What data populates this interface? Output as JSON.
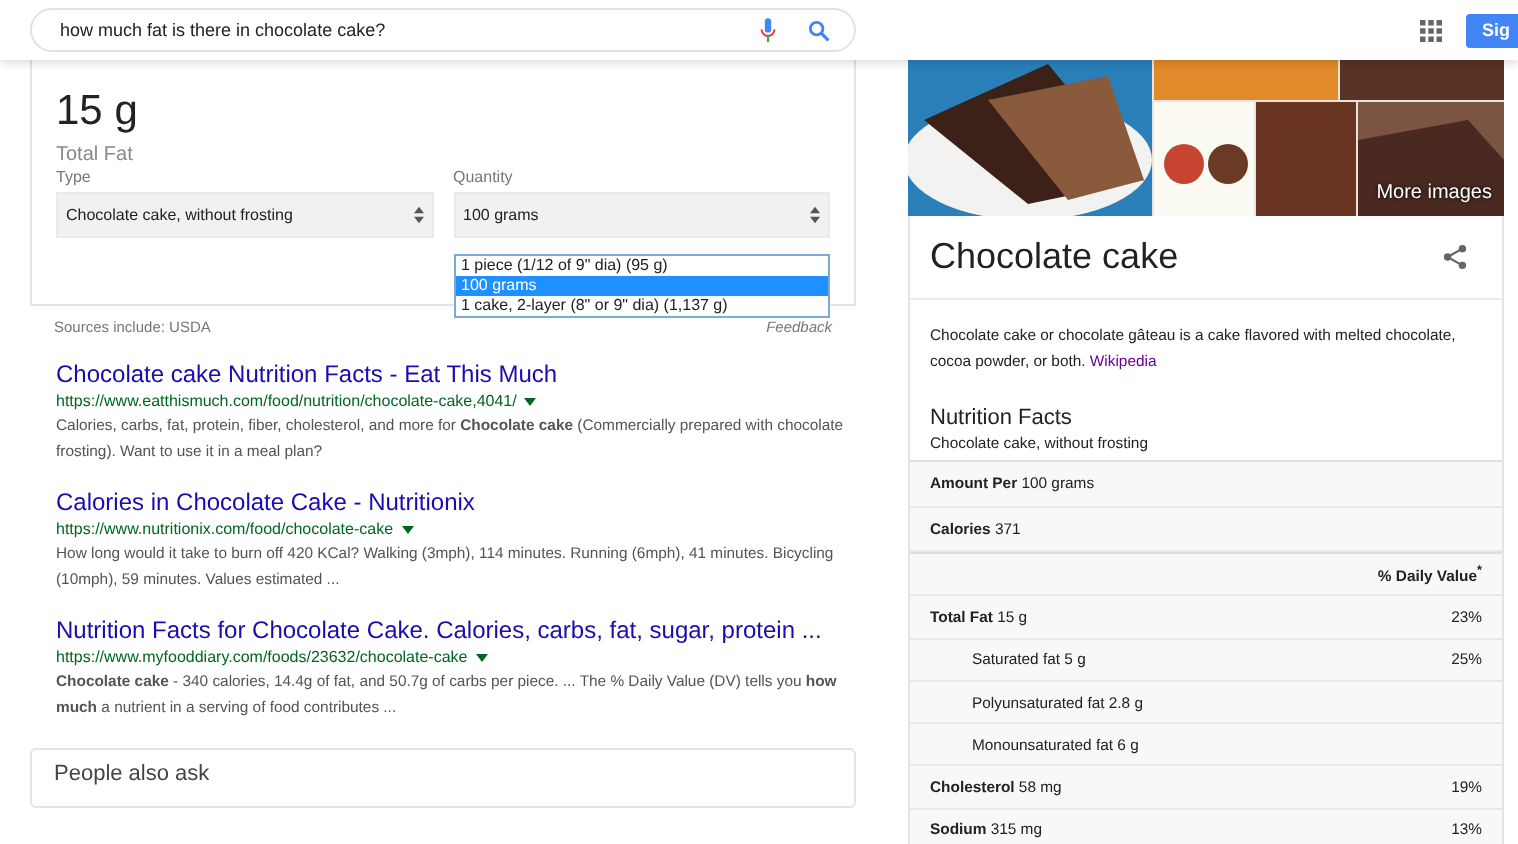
{
  "search": {
    "value": "how much fat is there in chocolate cake?"
  },
  "header": {
    "signin_label": "Sig"
  },
  "answer": {
    "value": "15 g",
    "label": "Total Fat",
    "type_label": "Type",
    "type_value": "Chocolate cake, without frosting",
    "quantity_label": "Quantity",
    "quantity_value": "100 grams",
    "quantity_options": [
      {
        "label": "1 piece (1/12 of 9\" dia) (95 g)",
        "selected": false
      },
      {
        "label": "100 grams",
        "selected": true
      },
      {
        "label": "1 cake, 2-layer (8\" or 9\" dia) (1,137 g)",
        "selected": false
      }
    ],
    "sources": "Sources include: USDA",
    "feedback": "Feedback"
  },
  "results": [
    {
      "title": "Chocolate cake Nutrition Facts - Eat This Much",
      "url": "https://www.eatthismuch.com/food/nutrition/chocolate-cake,4041/",
      "snippet": "Calories, carbs, fat, protein, fiber, cholesterol, and more for **Chocolate cake** (Commercially prepared with chocolate frosting). Want to use it in a meal plan?"
    },
    {
      "title": "Calories in Chocolate Cake - Nutritionix",
      "url": "https://www.nutritionix.com/food/chocolate-cake",
      "snippet": "How long would it take to burn off 420 KCal? Walking (3mph), 114 minutes. Running (6mph), 41 minutes. Bicycling (10mph), 59 minutes. Values estimated ..."
    },
    {
      "title": "Nutrition Facts for Chocolate Cake. Calories, carbs, fat, sugar, protein ...",
      "url": "https://www.myfooddiary.com/foods/23632/chocolate-cake",
      "snippet": "**Chocolate cake** - 340 calories, 14.4g of fat, and 50.7g of carbs per piece. ... The % Daily Value (DV) tells you **how much** a nutrient in a serving of food contributes ..."
    }
  ],
  "people_also_ask": "People also ask",
  "knowledge": {
    "more_images": "More images",
    "title": "Chocolate cake",
    "description": "Chocolate cake or chocolate gâteau is a cake flavored with melted chocolate, cocoa powder, or both.",
    "description_link": "Wikipedia",
    "nutrition_title": "Nutrition Facts",
    "nutrition_subtitle": "Chocolate cake, without frosting",
    "rows": [
      {
        "kind": "amount",
        "label": "Amount Per",
        "value": "100 grams"
      },
      {
        "kind": "amount",
        "label": "Calories",
        "value": "371"
      },
      {
        "kind": "dv_header",
        "text": "% Daily Value$^{*}$"
      },
      {
        "kind": "nutrient",
        "label": "Total Fat",
        "value": "15 g",
        "percent": "23%",
        "children": [
          {
            "label": "Saturated fat",
            "value": "5 g",
            "percent": "25%"
          },
          {
            "label": "Polyunsaturated fat",
            "value": "2.8 g"
          },
          {
            "label": "Monounsaturated fat",
            "value": "6 g"
          }
        ]
      },
      {
        "kind": "nutrient",
        "label": "Cholesterol",
        "value": "58 mg",
        "percent": "19%"
      },
      {
        "kind": "nutrient",
        "label": "Sodium",
        "value": "315 mg",
        "percent": "13%"
      }
    ]
  }
}
